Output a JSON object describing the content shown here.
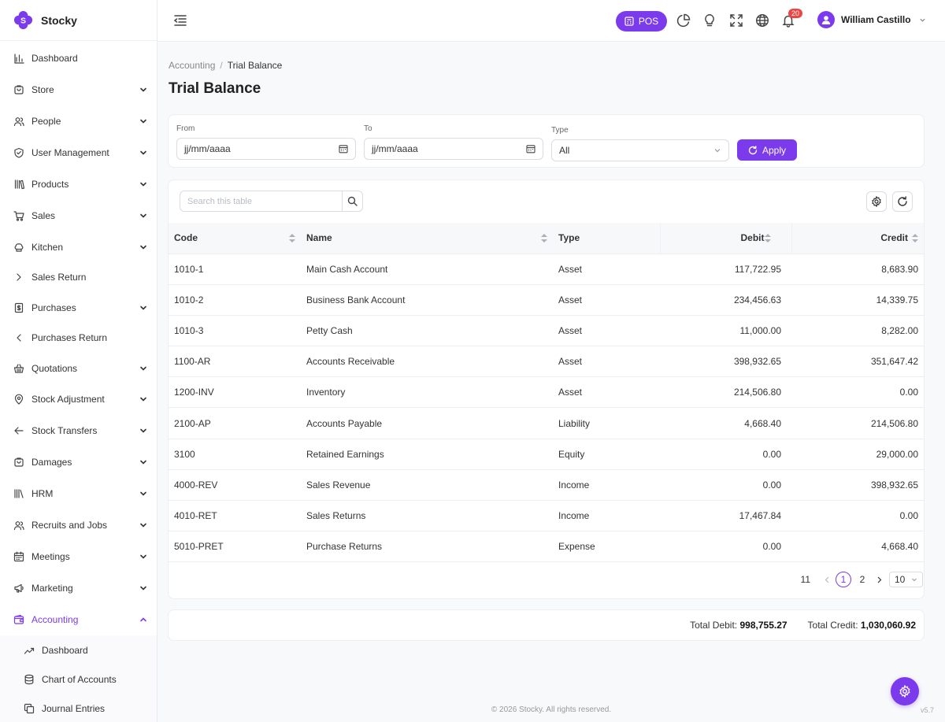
{
  "brand": {
    "name": "Stocky",
    "logo_letter": "S"
  },
  "sidebar": {
    "items": [
      {
        "label": "Dashboard",
        "icon": "bar-chart-icon"
      },
      {
        "label": "Store",
        "icon": "store-icon",
        "chevron": "down"
      },
      {
        "label": "People",
        "icon": "people-icon",
        "chevron": "down"
      },
      {
        "label": "User Management",
        "icon": "shield-check-icon",
        "chevron": "down"
      },
      {
        "label": "Products",
        "icon": "books-icon",
        "chevron": "down"
      },
      {
        "label": "Sales",
        "icon": "cart-icon",
        "chevron": "down"
      },
      {
        "label": "Kitchen",
        "icon": "chef-hat-icon",
        "chevron": "down"
      },
      {
        "label": "Sales Return",
        "icon": "chevron-right-icon"
      },
      {
        "label": "Purchases",
        "icon": "receipt-icon",
        "chevron": "down"
      },
      {
        "label": "Purchases Return",
        "icon": "chevron-left-icon"
      },
      {
        "label": "Quotations",
        "icon": "basket-icon",
        "chevron": "down"
      },
      {
        "label": "Stock Adjustment",
        "icon": "location-pin-icon",
        "chevron": "down"
      },
      {
        "label": "Stock Transfers",
        "icon": "arrow-left-icon",
        "chevron": "down"
      },
      {
        "label": "Damages",
        "icon": "box-icon",
        "chevron": "down"
      },
      {
        "label": "HRM",
        "icon": "library-icon",
        "chevron": "down"
      },
      {
        "label": "Recruits and Jobs",
        "icon": "users-icon",
        "chevron": "down"
      },
      {
        "label": "Meetings",
        "icon": "calendar-icon",
        "chevron": "down"
      },
      {
        "label": "Marketing",
        "icon": "megaphone-icon",
        "chevron": "down"
      },
      {
        "label": "Accounting",
        "icon": "wallet-icon",
        "chevron": "up",
        "active": true
      }
    ],
    "sub_items": [
      {
        "label": "Dashboard",
        "icon": "trending-up-icon"
      },
      {
        "label": "Chart of Accounts",
        "icon": "database-icon"
      },
      {
        "label": "Journal Entries",
        "icon": "copy-icon"
      }
    ]
  },
  "topbar": {
    "pos_label": "POS",
    "notification_count": "20",
    "user_name": "William Castillo",
    "icons": [
      "menu-fold-icon",
      "pie-chart-icon",
      "lightbulb-icon",
      "fullscreen-icon",
      "globe-icon",
      "bell-icon"
    ]
  },
  "breadcrumb": {
    "parent": "Accounting",
    "separator": "/",
    "current": "Trial Balance"
  },
  "page_title": "Trial Balance",
  "filters": {
    "from_label": "From",
    "from_value": "jj/mm/aaaa",
    "to_label": "To",
    "to_value": "jj/mm/aaaa",
    "type_label": "Type",
    "type_value": "All",
    "apply_label": "Apply"
  },
  "table": {
    "search_placeholder": "Search this table",
    "columns": [
      "Code",
      "Name",
      "Type",
      "Debit",
      "Credit"
    ],
    "rows": [
      [
        "1010-1",
        "Main Cash Account",
        "Asset",
        "117,722.95",
        "8,683.90"
      ],
      [
        "1010-2",
        "Business Bank Account",
        "Asset",
        "234,456.63",
        "14,339.75"
      ],
      [
        "1010-3",
        "Petty Cash",
        "Asset",
        "11,000.00",
        "8,282.00"
      ],
      [
        "1100-AR",
        "Accounts Receivable",
        "Asset",
        "398,932.65",
        "351,647.42"
      ],
      [
        "1200-INV",
        "Inventory",
        "Asset",
        "214,506.80",
        "0.00"
      ],
      [
        "2100-AP",
        "Accounts Payable",
        "Liability",
        "4,668.40",
        "214,506.80"
      ],
      [
        "3100",
        "Retained Earnings",
        "Equity",
        "0.00",
        "29,000.00"
      ],
      [
        "4000-REV",
        "Sales Revenue",
        "Income",
        "0.00",
        "398,932.65"
      ],
      [
        "4010-RET",
        "Sales Returns",
        "Income",
        "17,467.84",
        "0.00"
      ],
      [
        "5010-PRET",
        "Purchase Returns",
        "Expense",
        "0.00",
        "4,668.40"
      ]
    ]
  },
  "pagination": {
    "total": "11",
    "pages": [
      "1",
      "2"
    ],
    "current_page": "1",
    "page_size": "10"
  },
  "totals": {
    "debit_label": "Total Debit:",
    "debit_value": "998,755.27",
    "credit_label": "Total Credit:",
    "credit_value": "1,030,060.92"
  },
  "footer": {
    "copyright": "© 2026 Stocky. All rights reserved.",
    "version": "v5.7"
  },
  "colors": {
    "accent": "#7c3aed",
    "badge": "#ef4444"
  }
}
